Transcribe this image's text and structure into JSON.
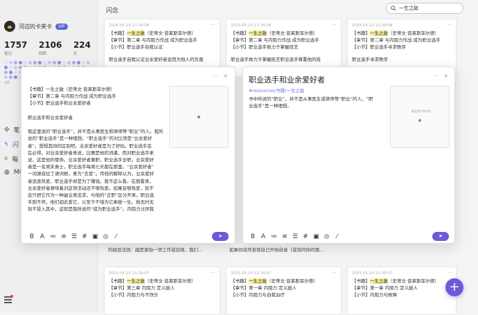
{
  "sidebar": {
    "username": "河边的卡芙卡",
    "vip": "VIP",
    "stats": [
      {
        "num": "1757",
        "label": "笔记"
      },
      {
        "num": "2106",
        "label": "回顾"
      },
      {
        "num": "224",
        "label": "天"
      }
    ],
    "heat_label": "3月",
    "nav": [
      "笔",
      "闪",
      "每",
      "Mi"
    ]
  },
  "main": {
    "title": "闪念",
    "search_value": "一生之敌"
  },
  "cards": [
    {
      "date": "2025-05-10 11:39:08",
      "lines": [
        [
          "【书籍】",
          "一生之敌",
          "（史蒂文·普莱斯菲尔德）"
        ],
        [
          "【章节】第二章 与内阻力作战 成为职业选手",
          "",
          ""
        ],
        [
          "【小节】职业选手自我认证",
          "",
          ""
        ]
      ],
      "body": "职业选手自我认证业余爱好者会因为他人的负面"
    },
    {
      "date": "2025-05-10 11:39:08",
      "lines": [
        [
          "【书籍】",
          "一生之敌",
          "（史蒂文·普莱斯菲尔德）"
        ],
        [
          "【章节】第二章 与内阻力作战 成为职业选手",
          "",
          ""
        ],
        [
          "【小节】职业选手致力于掌握技艺",
          "",
          ""
        ]
      ],
      "body": "职业选手致力于掌握技艺职业选手尊重他的技"
    },
    {
      "date": "2025-05-10 11:39:08",
      "lines": [
        [
          "【书籍】",
          "一生之敌",
          "（史蒂文·普莱斯菲尔德）"
        ],
        [
          "【章节】第二章 与内阻力作战 成为职业选手",
          "",
          ""
        ],
        [
          "【小节】职业选手寻求秩序",
          "",
          ""
        ]
      ],
      "body": "职业选手寻求秩序"
    },
    {
      "date": "2025-05-10 11:39:07",
      "lines": [
        [
          "【书籍】",
          "一生之敌",
          "（史蒂文·普莱斯菲尔德）"
        ],
        [
          "【章节】第三章 内阻力 定义敌人",
          "",
          ""
        ],
        [
          "【小节】内阻力与不快乐",
          "",
          ""
        ]
      ],
      "body": ""
    },
    {
      "date": "2025-05-10 11:39:07",
      "lines": [
        [
          "【书籍】",
          "一生之敌",
          "（史蒂文·普莱斯菲尔德）"
        ],
        [
          "【章节】第一章 内阻力 定义敌人",
          "",
          ""
        ],
        [
          "【小节】内阻力与自我治疗",
          "",
          ""
        ]
      ],
      "body": ""
    },
    {
      "date": "2025-05-10 11:39:07",
      "lines": [
        [
          "【书籍】",
          "一生之敌",
          "（史蒂文·普莱斯菲尔德）"
        ],
        [
          "【章节】第一章 内阻力 定义敌人",
          "",
          ""
        ],
        [
          "【小节】内阻力与故障",
          "",
          ""
        ]
      ],
      "body": ""
    }
  ],
  "peek_texts": {
    "left": "的经验法则：越是害怕一项工作或召唤，我们...",
    "mid": "如果你突然发现自己开始自省（或询问你的朋..."
  },
  "popup_left": {
    "lines": [
      "【书籍】一生之敌（史蒂文·普莱斯菲尔德）",
      "【章节】第二章 与内阻力作战 成为职业选手",
      "【小节】职业选手和业余爱好者",
      "",
      "职业选手和业余爱好者",
      "",
      "我这里说的“职业选手”，并不是从事医生和律师等“职业”的人。我所",
      "说的“职业选手”是一种理想。“职业选手”的对比项是“业余爱好",
      "者”。想想其间的区别吧。业余爱好者是为了好玩。职业选手态",
      "在必得。对业余爱好者来说，比赛是他的消遣，而对职业选手来",
      "说，这是他的使命。业余爱好者兼职，职业选手全职。业余爱好",
      "者是一名周末勇士，职业选手每周七天都在那里。“业余爱好者”",
      "一词源自拉丁语词根，意为“去爱”。传统的解释认为，业余爱好",
      "者追逐热爱，职业选手却是为了赚钱。我不这么看。在我看来，",
      "业余爱好者意味着对这项活动还不够热爱。如果足够热爱，就不",
      "会只把它作为一种副业来追求，与他的“正职”区分开来。职业选",
      "手则不然，他们如此爱它，以至于不惜为它奉献一生。他无时无",
      "刻不投入其中，这就是我所说的“成为职业选手”。内阻力讨厌我"
    ],
    "toolbar": [
      "B",
      "A",
      "≔",
      "≡",
      "☰",
      "#",
      "▣",
      "◎",
      "⁄"
    ],
    "send": "➤"
  },
  "popup_right": {
    "title": "职业选手和业余爱好者",
    "tags": "#resources/书籍/一生之敌",
    "body": [
      "书中所说的“职业”，并不是从事医生或律师等“职业”的人，“职",
      "业选手”是一种理想。"
    ],
    "thumb_label": "职业选手和业余...",
    "toolbar": [
      "B",
      "A",
      "≔",
      "≡",
      "☰",
      "#",
      "▣",
      "◎",
      "⁄"
    ],
    "send": "➤",
    "faded_heading": "选手和业余爱好者"
  }
}
